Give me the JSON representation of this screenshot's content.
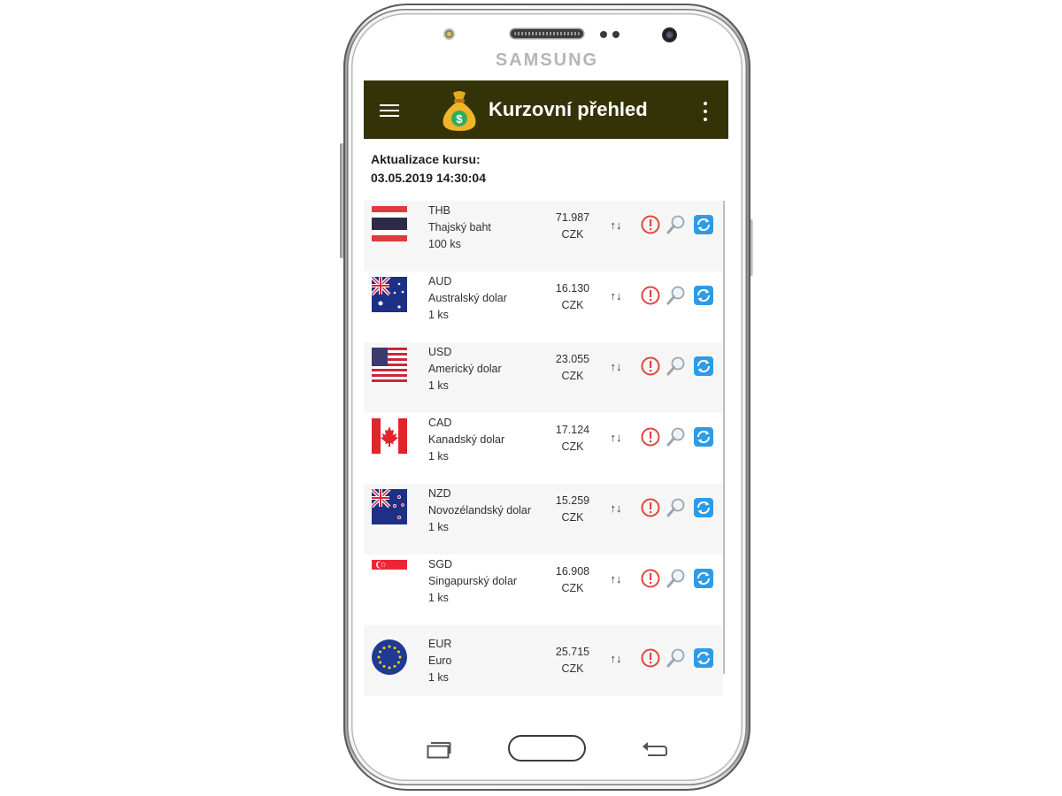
{
  "device": {
    "brand": "SAMSUNG"
  },
  "appbar": {
    "title": "Kurzovní přehled"
  },
  "update": {
    "label": "Aktualizace kursu:",
    "timestamp": "03.05.2019 14:30:04"
  },
  "rows": [
    {
      "code": "THB",
      "name": "Thajský baht",
      "unit": "100 ks",
      "rate": "71.987",
      "currency": "CZK",
      "flag": "thailand-flag"
    },
    {
      "code": "AUD",
      "name": "Australský dolar",
      "unit": "1 ks",
      "rate": "16.130",
      "currency": "CZK",
      "flag": "australia-flag"
    },
    {
      "code": "USD",
      "name": "Americký dolar",
      "unit": "1 ks",
      "rate": "23.055",
      "currency": "CZK",
      "flag": "usa-flag"
    },
    {
      "code": "CAD",
      "name": "Kanadský dolar",
      "unit": "1 ks",
      "rate": "17.124",
      "currency": "CZK",
      "flag": "canada-flag"
    },
    {
      "code": "NZD",
      "name": "Novozélandský dolar",
      "unit": "1 ks",
      "rate": "15.259",
      "currency": "CZK",
      "flag": "new-zealand-flag"
    },
    {
      "code": "SGD",
      "name": "Singapurský dolar",
      "unit": "1 ks",
      "rate": "16.908",
      "currency": "CZK",
      "flag": "singapore-flag"
    },
    {
      "code": "EUR",
      "name": "Euro",
      "unit": "1 ks",
      "rate": "25.715",
      "currency": "CZK",
      "flag": "eu-flag"
    }
  ],
  "icons": {
    "swap": "↑↓",
    "alert": "alert-icon",
    "search": "search-icon",
    "refresh": "refresh-icon"
  },
  "colors": {
    "appbar": "#333307",
    "alert": "#e0463c",
    "refresh": "#2e9be6"
  }
}
